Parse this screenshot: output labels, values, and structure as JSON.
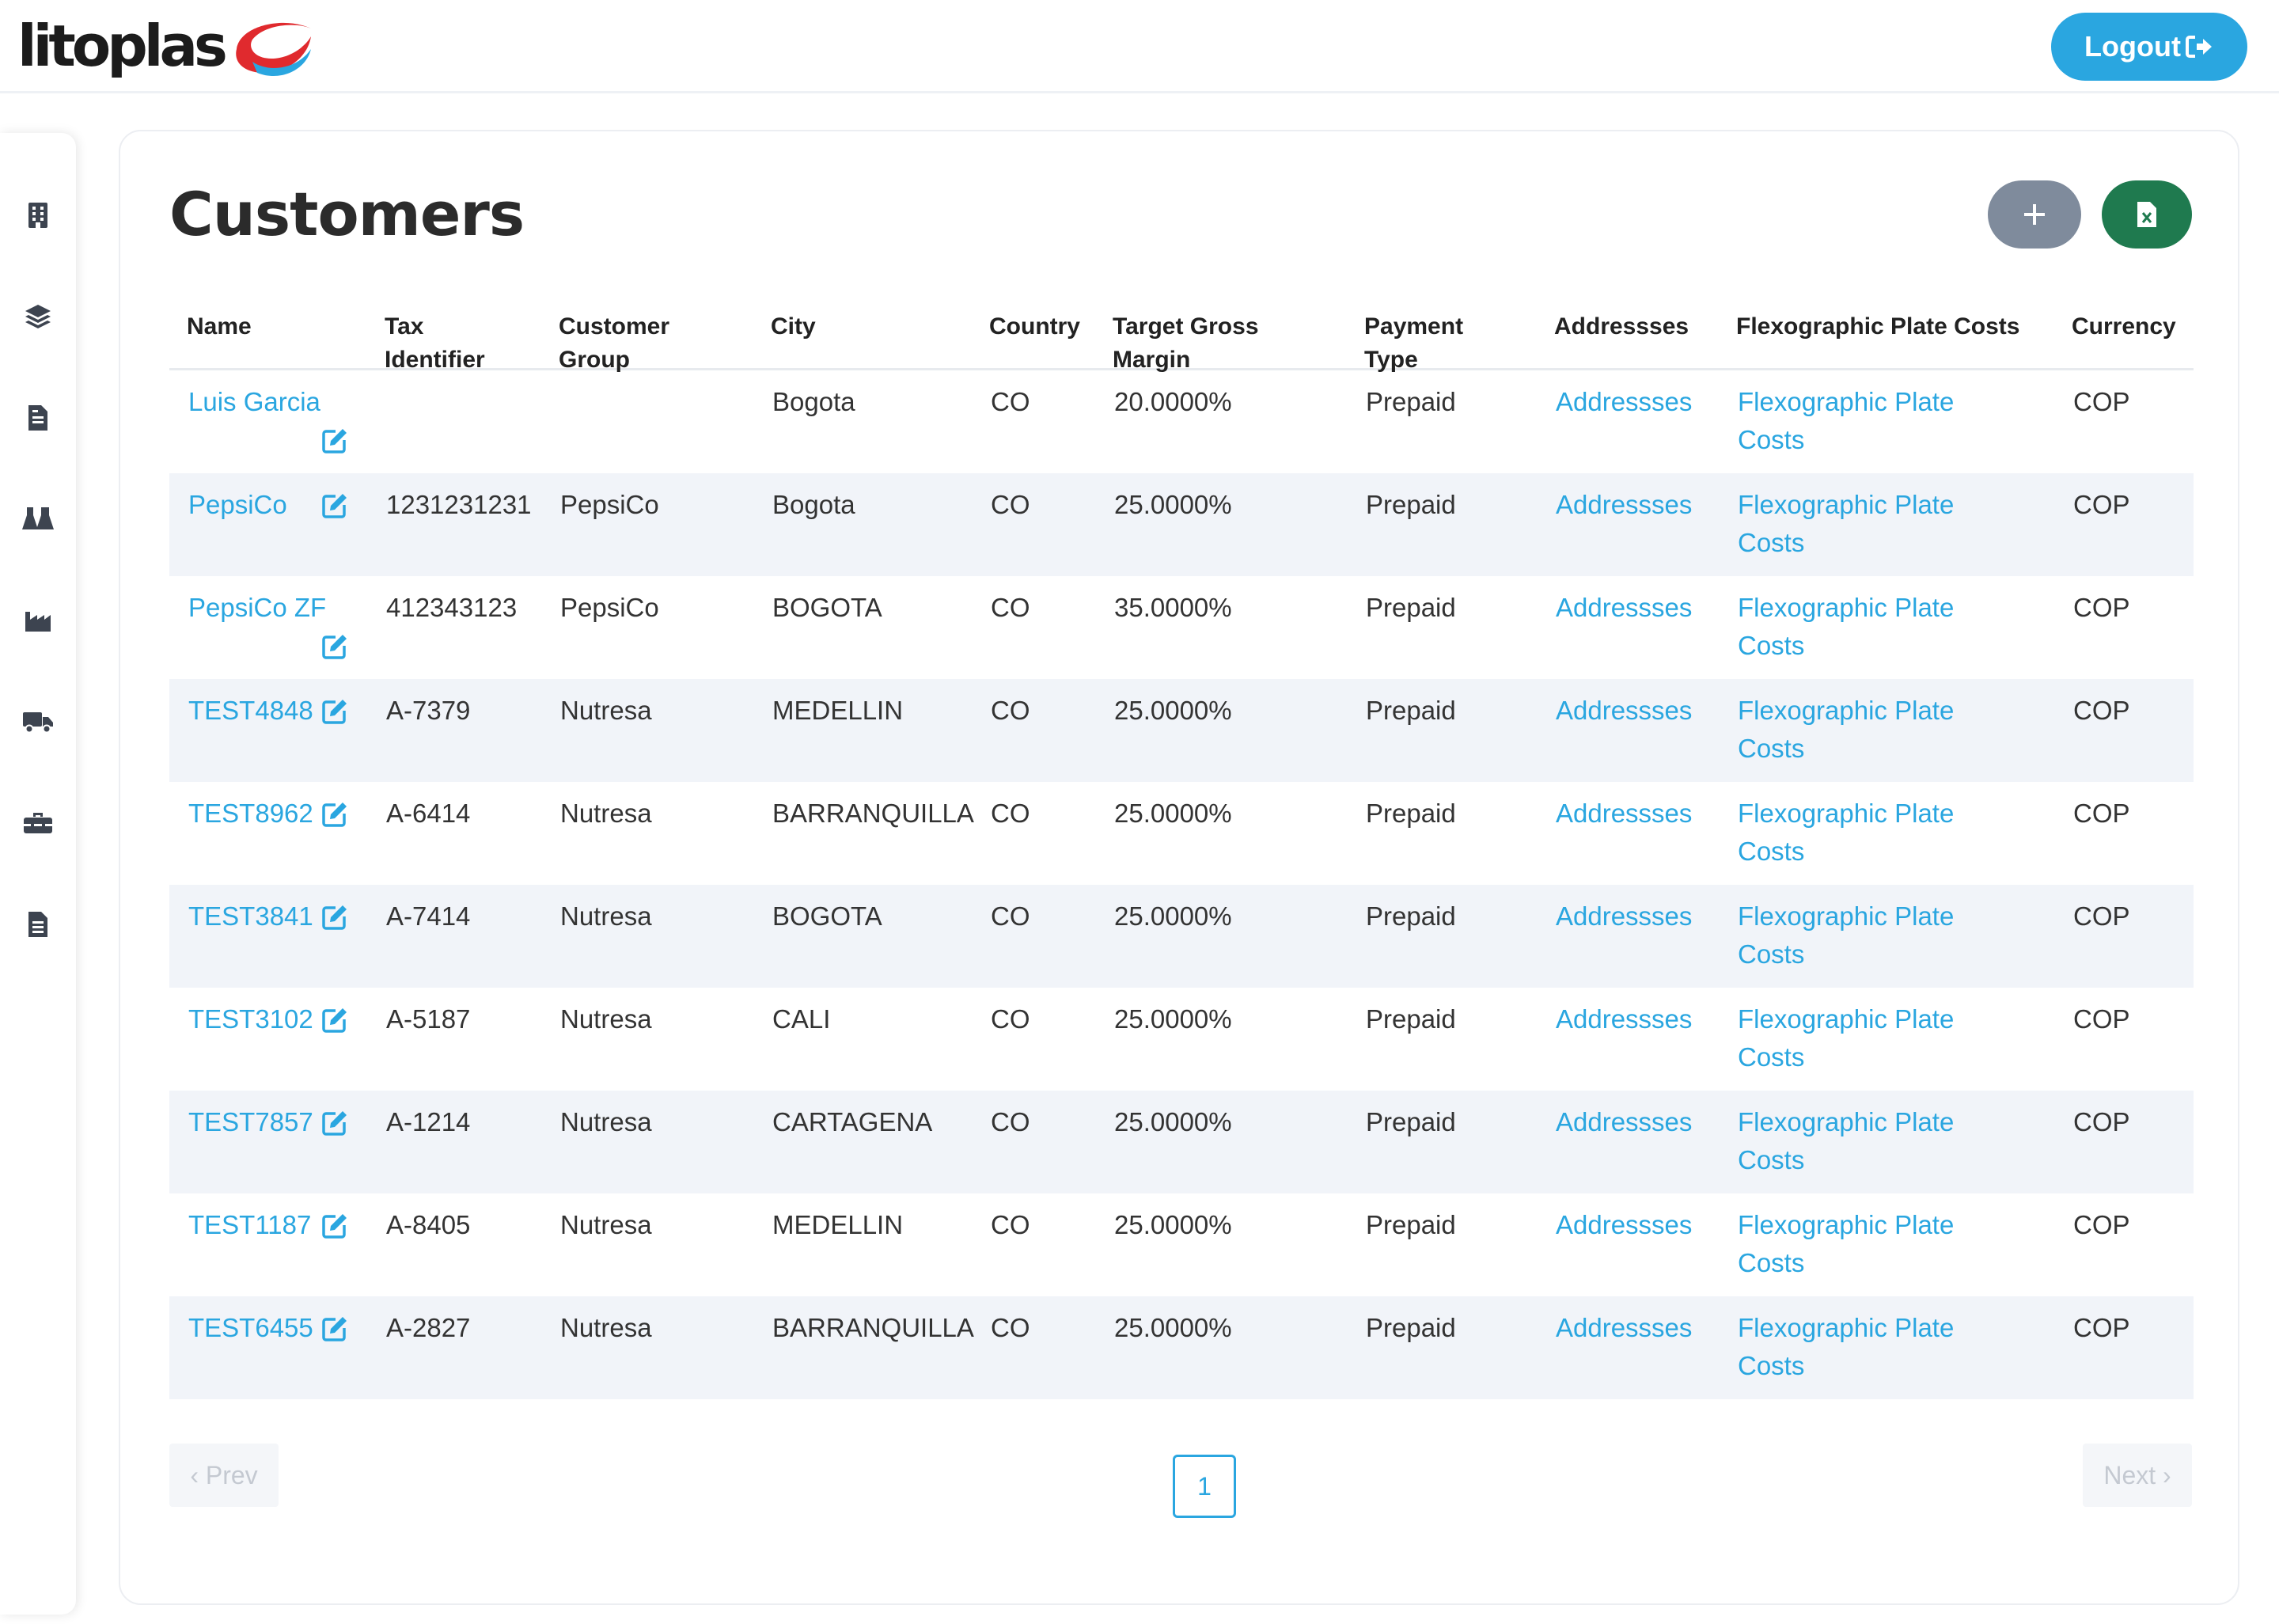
{
  "brand": {
    "name": "litoplas"
  },
  "header": {
    "logout_label": "Logout"
  },
  "sidebar": {
    "items": [
      {
        "icon": "building-icon"
      },
      {
        "icon": "layers-icon"
      },
      {
        "icon": "invoice-icon"
      },
      {
        "icon": "flask-icon"
      },
      {
        "icon": "factory-icon"
      },
      {
        "icon": "truck-icon"
      },
      {
        "icon": "toolbox-icon"
      },
      {
        "icon": "document-icon"
      }
    ]
  },
  "page": {
    "title": "Customers",
    "add_button_icon": "plus-icon",
    "export_button_icon": "excel-file-icon"
  },
  "table": {
    "headers": {
      "name": "Name",
      "tax_1": "Tax",
      "tax_2": "Identifier",
      "group_1": "Customer",
      "group_2": "Group",
      "city": "City",
      "country": "Country",
      "margin_1": "Target Gross",
      "margin_2": "Margin",
      "payment_1": "Payment",
      "payment_2": "Type",
      "addresses": "Addressses",
      "plate_costs": "Flexographic Plate Costs",
      "currency": "Currency"
    },
    "rows": [
      {
        "name": "Luis Garcia",
        "tax_id": "",
        "group": "",
        "city": "Bogota",
        "country": "CO",
        "margin": "20.0000%",
        "payment": "Prepaid",
        "addresses": "Addressses",
        "plate_1": "Flexographic Plate",
        "plate_2": "Costs",
        "currency": "COP"
      },
      {
        "name": "PepsiCo",
        "tax_id": "1231231231",
        "group": "PepsiCo",
        "city": "Bogota",
        "country": "CO",
        "margin": "25.0000%",
        "payment": "Prepaid",
        "addresses": "Addressses",
        "plate_1": "Flexographic Plate",
        "plate_2": "Costs",
        "currency": "COP"
      },
      {
        "name": "PepsiCo ZF",
        "tax_id": "412343123",
        "group": "PepsiCo",
        "city": "BOGOTA",
        "country": "CO",
        "margin": "35.0000%",
        "payment": "Prepaid",
        "addresses": "Addressses",
        "plate_1": "Flexographic Plate",
        "plate_2": "Costs",
        "currency": "COP"
      },
      {
        "name": "TEST4848",
        "tax_id": "A-7379",
        "group": "Nutresa",
        "city": "MEDELLIN",
        "country": "CO",
        "margin": "25.0000%",
        "payment": "Prepaid",
        "addresses": "Addressses",
        "plate_1": "Flexographic Plate",
        "plate_2": "Costs",
        "currency": "COP"
      },
      {
        "name": "TEST8962",
        "tax_id": "A-6414",
        "group": "Nutresa",
        "city": "BARRANQUILLA",
        "country": "CO",
        "margin": "25.0000%",
        "payment": "Prepaid",
        "addresses": "Addressses",
        "plate_1": "Flexographic Plate",
        "plate_2": "Costs",
        "currency": "COP"
      },
      {
        "name": "TEST3841",
        "tax_id": "A-7414",
        "group": "Nutresa",
        "city": "BOGOTA",
        "country": "CO",
        "margin": "25.0000%",
        "payment": "Prepaid",
        "addresses": "Addressses",
        "plate_1": "Flexographic Plate",
        "plate_2": "Costs",
        "currency": "COP"
      },
      {
        "name": "TEST3102",
        "tax_id": "A-5187",
        "group": "Nutresa",
        "city": "CALI",
        "country": "CO",
        "margin": "25.0000%",
        "payment": "Prepaid",
        "addresses": "Addressses",
        "plate_1": "Flexographic Plate",
        "plate_2": "Costs",
        "currency": "COP"
      },
      {
        "name": "TEST7857",
        "tax_id": "A-1214",
        "group": "Nutresa",
        "city": "CARTAGENA",
        "country": "CO",
        "margin": "25.0000%",
        "payment": "Prepaid",
        "addresses": "Addressses",
        "plate_1": "Flexographic Plate",
        "plate_2": "Costs",
        "currency": "COP"
      },
      {
        "name": "TEST1187",
        "tax_id": "A-8405",
        "group": "Nutresa",
        "city": "MEDELLIN",
        "country": "CO",
        "margin": "25.0000%",
        "payment": "Prepaid",
        "addresses": "Addressses",
        "plate_1": "Flexographic Plate",
        "plate_2": "Costs",
        "currency": "COP"
      },
      {
        "name": "TEST6455",
        "tax_id": "A-2827",
        "group": "Nutresa",
        "city": "BARRANQUILLA",
        "country": "CO",
        "margin": "25.0000%",
        "payment": "Prepaid",
        "addresses": "Addressses",
        "plate_1": "Flexographic Plate",
        "plate_2": "Costs",
        "currency": "COP"
      }
    ]
  },
  "pagination": {
    "prev_label": "‹ Prev",
    "next_label": "Next ›",
    "current_page": "1"
  },
  "colors": {
    "accent": "#2aa6e0",
    "add_button": "#7f8b9c",
    "export_button": "#1f7a4f",
    "stripe": "#f1f4f9"
  }
}
